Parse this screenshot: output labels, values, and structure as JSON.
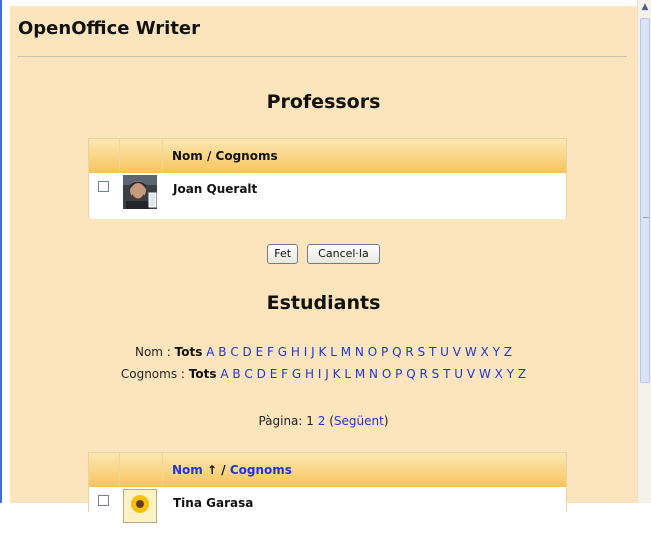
{
  "page": {
    "title": "OpenOffice Writer"
  },
  "teachers": {
    "title": "Professors",
    "column_header": "Nom / Cognoms",
    "rows": [
      {
        "name": "Joan Queralt"
      }
    ]
  },
  "buttons": {
    "done": "Fet",
    "cancel": "Cancel·la"
  },
  "students": {
    "title": "Estudiants",
    "first_name_filter": {
      "label": "Nom",
      "separator": " : ",
      "all": "Tots",
      "letters": [
        "A",
        "B",
        "C",
        "D",
        "E",
        "F",
        "G",
        "H",
        "I",
        "J",
        "K",
        "L",
        "M",
        "N",
        "O",
        "P",
        "Q",
        "R",
        "S",
        "T",
        "U",
        "V",
        "W",
        "X",
        "Y",
        "Z"
      ]
    },
    "last_name_filter": {
      "label": "Cognoms",
      "separator": " : ",
      "all": "Tots",
      "letters": [
        "A",
        "B",
        "C",
        "D",
        "E",
        "F",
        "G",
        "H",
        "I",
        "J",
        "K",
        "L",
        "M",
        "N",
        "O",
        "P",
        "Q",
        "R",
        "S",
        "T",
        "U",
        "V",
        "W",
        "X",
        "Y",
        "Z"
      ]
    },
    "pager": {
      "label": "Pàgina:",
      "current": "1",
      "next_page": "2",
      "next_label": "Següent"
    },
    "header": {
      "name": "Nom",
      "sort_arrow": "↑",
      "separator": "/",
      "surname": "Cognoms"
    },
    "rows": [
      {
        "name": "Tina Garasa"
      }
    ]
  },
  "colors": {
    "panel": "#fce5bd",
    "header_gradient_top": "#fce7b4",
    "header_gradient_bottom": "#f7c45b",
    "link": "#1f35d6",
    "left_edge": "#3f6fd3"
  }
}
